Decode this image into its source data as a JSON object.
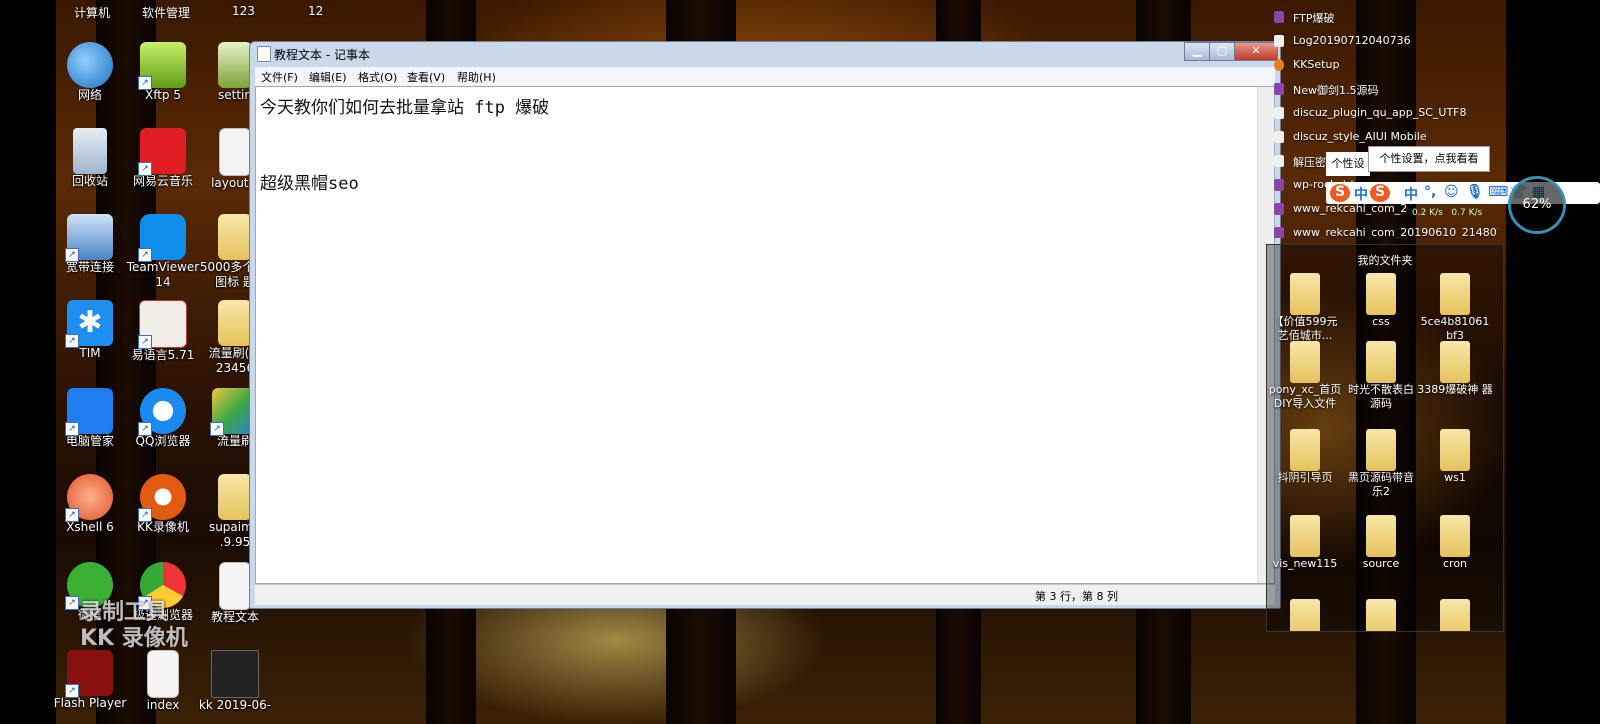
{
  "desktop": {
    "top_row": [
      "计算机",
      "软件管理",
      "123",
      "12"
    ],
    "icons": [
      {
        "label": "网络",
        "icon": "network-icon"
      },
      {
        "label": "Xftp 5",
        "icon": "xftp-icon"
      },
      {
        "label": "settin",
        "icon": "document-icon"
      },
      {
        "label": "回收站",
        "icon": "recycle-bin-icon"
      },
      {
        "label": "网易云音乐",
        "icon": "netease-music-icon"
      },
      {
        "label": "layout.c",
        "icon": "document-icon"
      },
      {
        "label": "宽带连接",
        "icon": "broadband-icon"
      },
      {
        "label": "TeamViewer 14",
        "icon": "teamviewer-icon"
      },
      {
        "label": "5000多个 块图标 题",
        "icon": "folder-icon"
      },
      {
        "label": "TIM",
        "icon": "tim-icon"
      },
      {
        "label": "易语言5.71",
        "icon": "eyuyan-icon"
      },
      {
        "label": "流量刷(密 23456",
        "icon": "folder-icon"
      },
      {
        "label": "电脑管家",
        "icon": "pc-manager-icon"
      },
      {
        "label": "QQ浏览器",
        "icon": "qq-browser-icon"
      },
      {
        "label": "流量刷",
        "icon": "shortcut-icon"
      },
      {
        "label": "Xshell 6",
        "icon": "xshell-icon"
      },
      {
        "label": "KK录像机",
        "icon": "kk-recorder-icon"
      },
      {
        "label": "supaimir .9.95",
        "icon": "folder-icon"
      },
      {
        "label": "微信",
        "icon": "wechat-icon"
      },
      {
        "label": "极速浏览器",
        "icon": "chrome-icon"
      },
      {
        "label": "教程文本",
        "icon": "document-icon"
      },
      {
        "label": "Flash Player",
        "icon": "flash-player-icon"
      },
      {
        "label": "index",
        "icon": "document-icon"
      },
      {
        "label": "kk 2019-06-",
        "icon": "video-icon"
      }
    ]
  },
  "notepad": {
    "title": "教程文本 - 记事本",
    "menu": [
      "文件(F)",
      "编辑(E)",
      "格式(O)",
      "查看(V)",
      "帮助(H)"
    ],
    "content": "今天教你们如何去批量拿站 ftp 爆破\n\n超级黑帽seo",
    "status": "第 3 行，第 8 列"
  },
  "recent_files": [
    "FTP爆破",
    "Log20190712040736",
    "KKSetup",
    "New御剑1.5源码",
    "discuz_plugin_qu_app_SC_UTF8",
    "discuz_style_AIUI Mobile",
    "解压密",
    "wp-rocket.tar",
    "www_rekcahi_com_2",
    "www_rekcahi_com_20190610_214807"
  ],
  "my_files": {
    "header": "我的文件夹",
    "items": [
      "【价值599元 艺佰城市...",
      "css",
      "5ce4b81061 bf3",
      "pony_xc_首页 DIY导入文件",
      "时光不散表白 源码",
      "3389爆破神 器",
      "抖阴引导页",
      "黑页源码带音 乐2",
      "ws1",
      "vis_new115",
      "source",
      "cron"
    ]
  },
  "tooltip": {
    "text": "个性设置，点我看看",
    "behind": "个性设"
  },
  "ime": {
    "mode": "中",
    "speed_up": "0.2 K/s",
    "speed_down": "0.7 K/s",
    "gauge": "62%"
  },
  "watermark": {
    "line1": "录制工具",
    "line2": "KK 录像机"
  }
}
